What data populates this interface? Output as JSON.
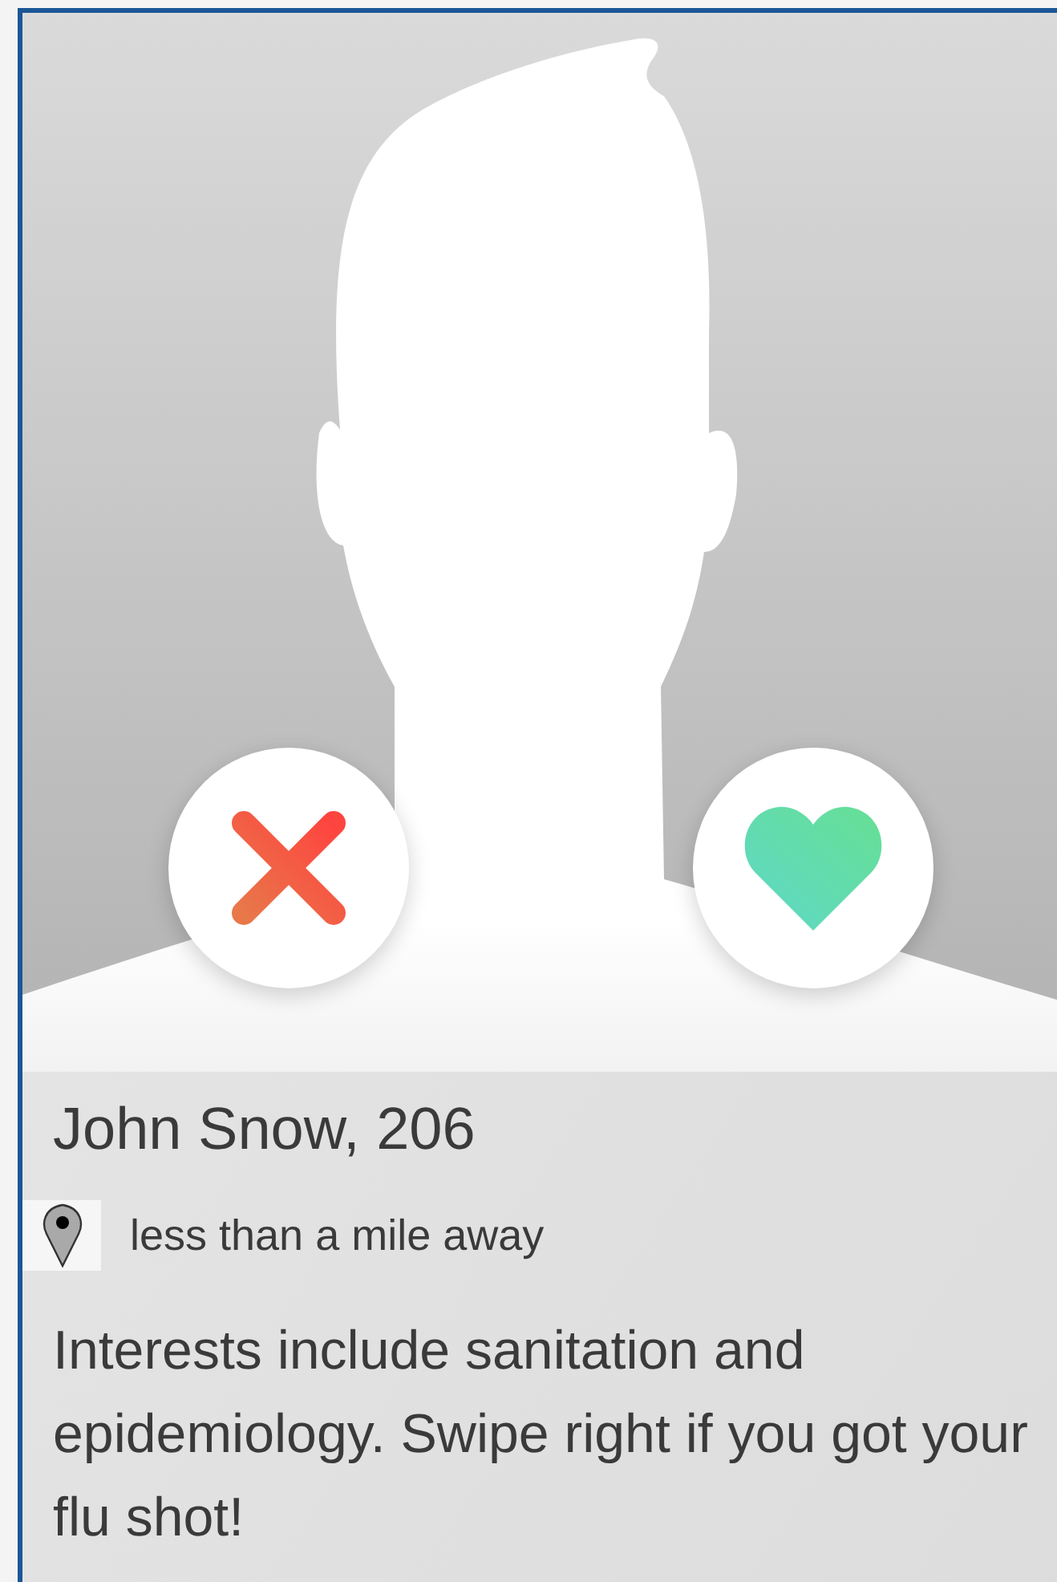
{
  "profile": {
    "actions": [
      {
        "kind": "reject"
      },
      {
        "kind": "like"
      }
    ],
    "name": "John Snow, 206",
    "distance": "less than a mile away",
    "bio": "Interests include sanitation and epidemiology. Swipe right if you got your flu shot!"
  }
}
